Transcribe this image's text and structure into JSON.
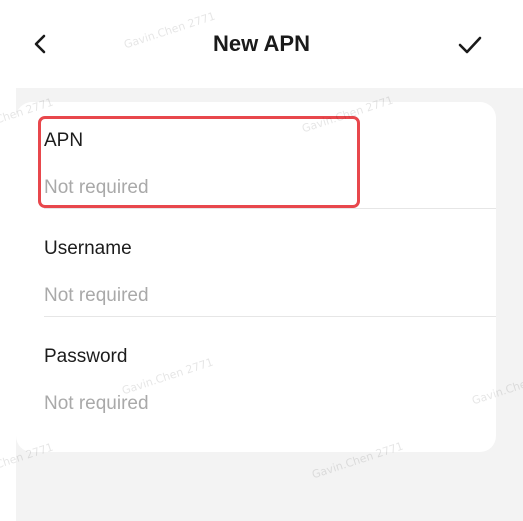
{
  "header": {
    "title": "New APN"
  },
  "fields": [
    {
      "label": "APN",
      "placeholder": "Not required",
      "value": ""
    },
    {
      "label": "Username",
      "placeholder": "Not required",
      "value": ""
    },
    {
      "label": "Password",
      "placeholder": "Not required",
      "value": ""
    }
  ],
  "watermark": "Gavin.Chen 2771",
  "colors": {
    "highlight": "#e8474c",
    "background": "#f3f3f3",
    "card": "#ffffff"
  },
  "icons": {
    "back": "chevron-left-icon",
    "confirm": "checkmark-icon"
  }
}
